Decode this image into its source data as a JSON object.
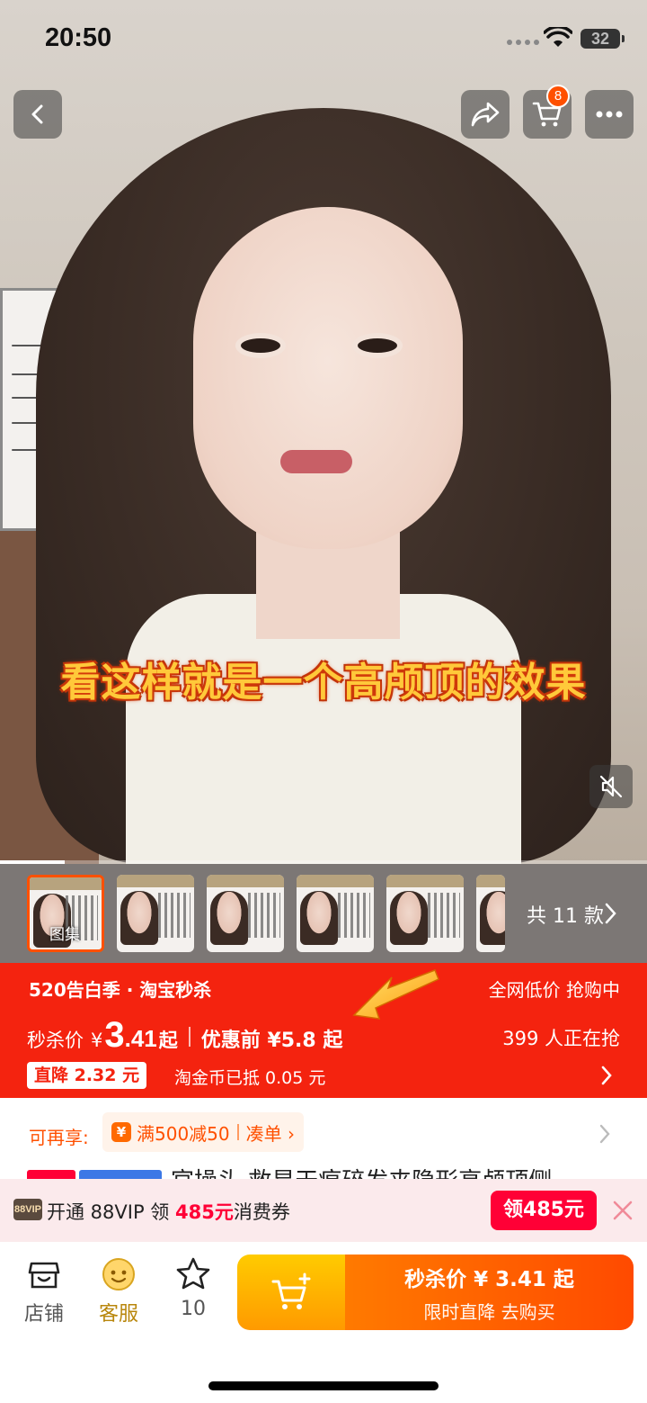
{
  "status_bar": {
    "time": "20:50",
    "battery": "32"
  },
  "header": {
    "cart_count": "8"
  },
  "video": {
    "caption": "看这样就是一个高颅顶的效果",
    "progress": 0.1
  },
  "gallery": {
    "first_thumb_label": "图集",
    "variants_label": "共 11 款"
  },
  "promo": {
    "event": "520告白季 · 淘宝秒杀",
    "lowest_tag": "全网低价 抢购中",
    "price_label": "秒杀价",
    "currency": "¥",
    "price_int": "3",
    "price_dec": ".41",
    "price_suffix": "起",
    "before_label": "优惠前 ¥5.8 起",
    "buyers": "399 人正在抢",
    "direct_drop": "直降 2.32 元",
    "coin_offset": "淘金币已抵 0.05 元"
  },
  "coupons": {
    "label": "可再享:",
    "yen_icon": "¥",
    "discount": "满500减50",
    "combine": "凑单 ›"
  },
  "title_peek": "官操头 救星天痕碎发夹隐形高颅顶侧",
  "vip": {
    "logo": "88VIP",
    "text_pre": "开通 88VIP 领 ",
    "amount": "485元",
    "text_post": "消费券",
    "claim": "领485元"
  },
  "bottom_nav": {
    "shop": "店铺",
    "service": "客服",
    "favorites": "10"
  },
  "buy_button": {
    "line1": "秒杀价 ¥ 3.41 起",
    "line2": "限时直降  去购买"
  },
  "colors": {
    "accent": "#ff5000",
    "promo_red": "#f4230f",
    "vip_red": "#ff0036"
  }
}
